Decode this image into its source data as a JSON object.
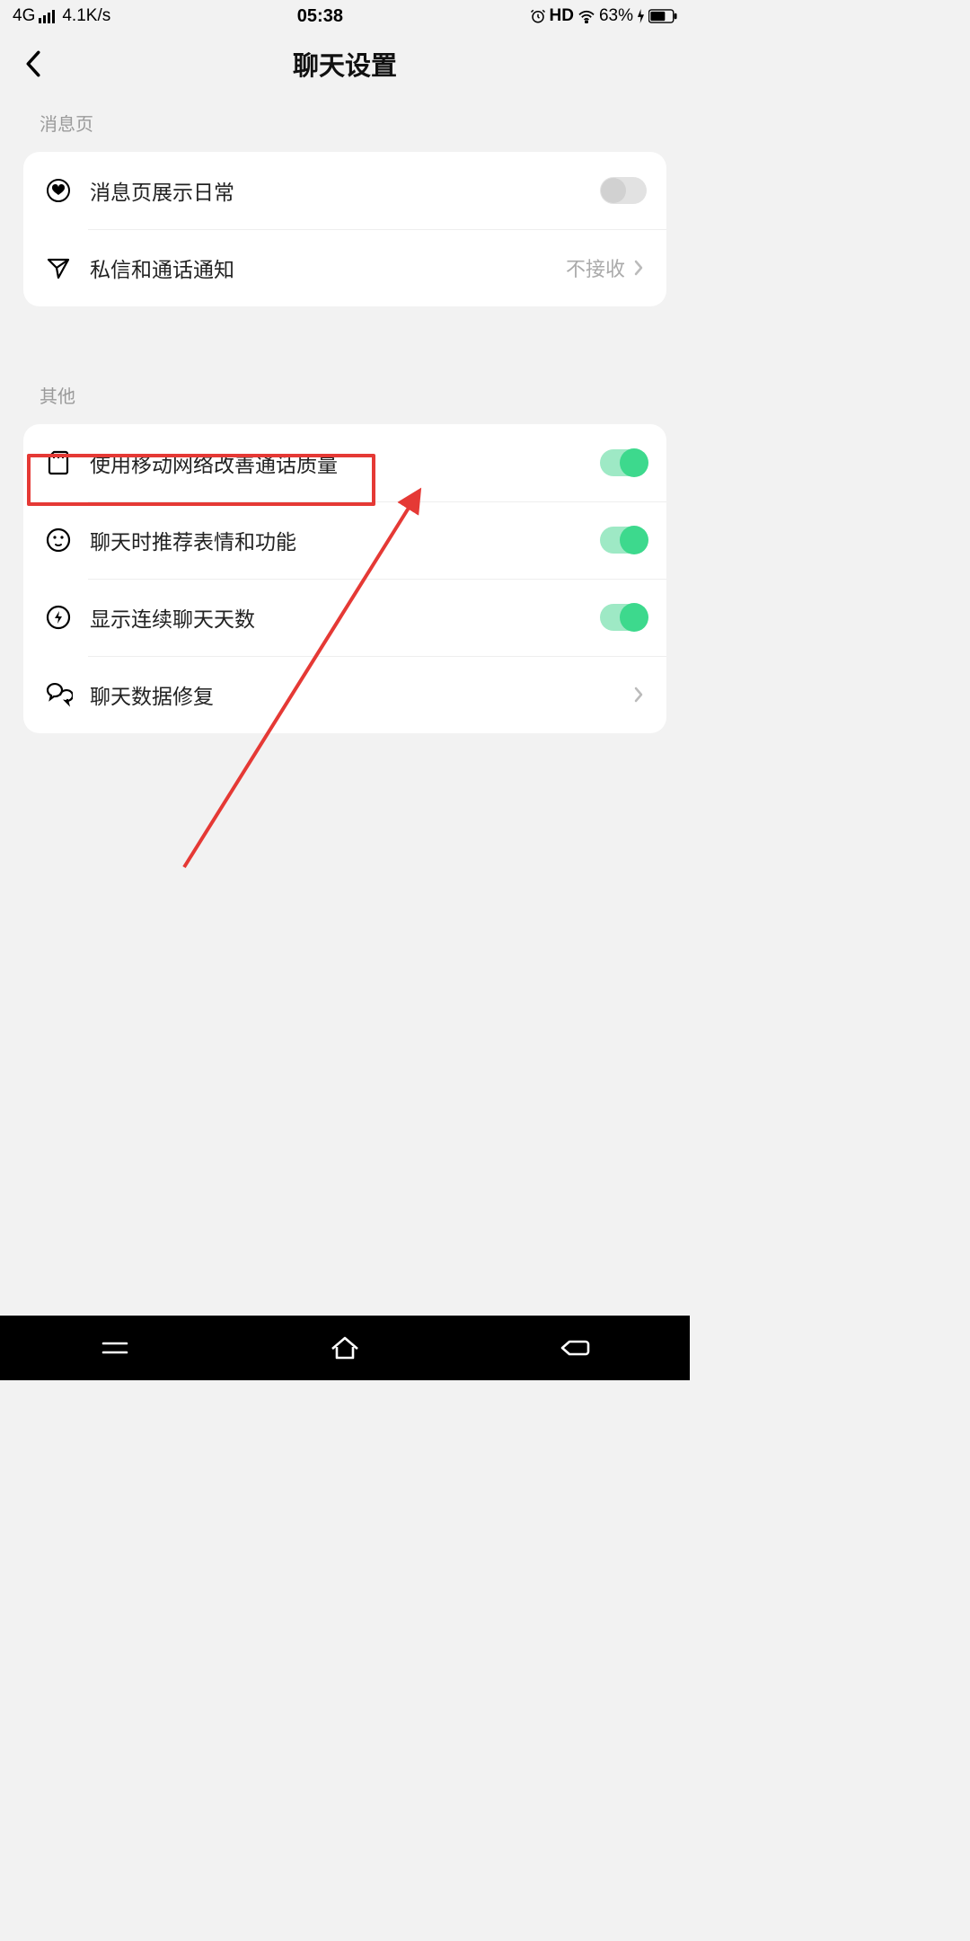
{
  "status": {
    "network": "4G",
    "speed": "4.1K/s",
    "time": "05:38",
    "hd": "HD",
    "battery_pct": "63%"
  },
  "header": {
    "title": "聊天设置"
  },
  "sections": {
    "messages": {
      "header": "消息页",
      "items": [
        {
          "label": "消息页展示日常"
        },
        {
          "label": "私信和通话通知",
          "value": "不接收"
        }
      ]
    },
    "other": {
      "header": "其他",
      "items": [
        {
          "label": "使用移动网络改善通话质量"
        },
        {
          "label": "聊天时推荐表情和功能"
        },
        {
          "label": "显示连续聊天天数"
        },
        {
          "label": "聊天数据修复"
        }
      ]
    }
  }
}
